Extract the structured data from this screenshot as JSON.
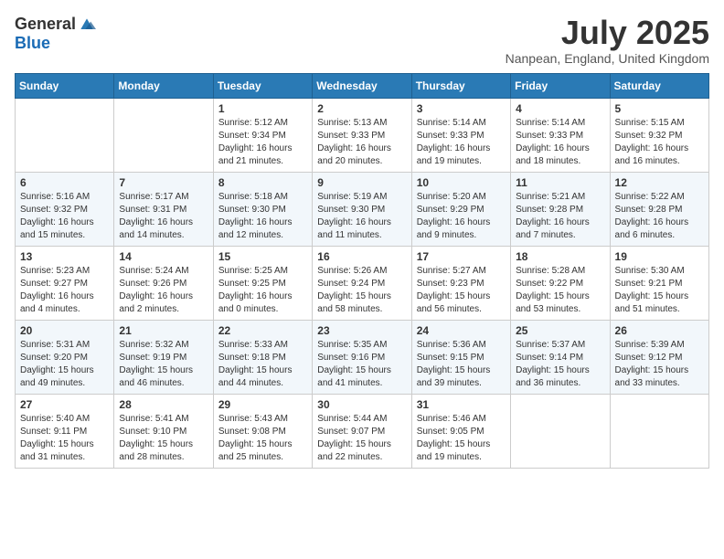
{
  "header": {
    "logo_general": "General",
    "logo_blue": "Blue",
    "month_title": "July 2025",
    "location": "Nanpean, England, United Kingdom"
  },
  "days_of_week": [
    "Sunday",
    "Monday",
    "Tuesday",
    "Wednesday",
    "Thursday",
    "Friday",
    "Saturday"
  ],
  "weeks": [
    [
      null,
      null,
      {
        "day": "1",
        "sunrise": "Sunrise: 5:12 AM",
        "sunset": "Sunset: 9:34 PM",
        "daylight": "Daylight: 16 hours and 21 minutes."
      },
      {
        "day": "2",
        "sunrise": "Sunrise: 5:13 AM",
        "sunset": "Sunset: 9:33 PM",
        "daylight": "Daylight: 16 hours and 20 minutes."
      },
      {
        "day": "3",
        "sunrise": "Sunrise: 5:14 AM",
        "sunset": "Sunset: 9:33 PM",
        "daylight": "Daylight: 16 hours and 19 minutes."
      },
      {
        "day": "4",
        "sunrise": "Sunrise: 5:14 AM",
        "sunset": "Sunset: 9:33 PM",
        "daylight": "Daylight: 16 hours and 18 minutes."
      },
      {
        "day": "5",
        "sunrise": "Sunrise: 5:15 AM",
        "sunset": "Sunset: 9:32 PM",
        "daylight": "Daylight: 16 hours and 16 minutes."
      }
    ],
    [
      {
        "day": "6",
        "sunrise": "Sunrise: 5:16 AM",
        "sunset": "Sunset: 9:32 PM",
        "daylight": "Daylight: 16 hours and 15 minutes."
      },
      {
        "day": "7",
        "sunrise": "Sunrise: 5:17 AM",
        "sunset": "Sunset: 9:31 PM",
        "daylight": "Daylight: 16 hours and 14 minutes."
      },
      {
        "day": "8",
        "sunrise": "Sunrise: 5:18 AM",
        "sunset": "Sunset: 9:30 PM",
        "daylight": "Daylight: 16 hours and 12 minutes."
      },
      {
        "day": "9",
        "sunrise": "Sunrise: 5:19 AM",
        "sunset": "Sunset: 9:30 PM",
        "daylight": "Daylight: 16 hours and 11 minutes."
      },
      {
        "day": "10",
        "sunrise": "Sunrise: 5:20 AM",
        "sunset": "Sunset: 9:29 PM",
        "daylight": "Daylight: 16 hours and 9 minutes."
      },
      {
        "day": "11",
        "sunrise": "Sunrise: 5:21 AM",
        "sunset": "Sunset: 9:28 PM",
        "daylight": "Daylight: 16 hours and 7 minutes."
      },
      {
        "day": "12",
        "sunrise": "Sunrise: 5:22 AM",
        "sunset": "Sunset: 9:28 PM",
        "daylight": "Daylight: 16 hours and 6 minutes."
      }
    ],
    [
      {
        "day": "13",
        "sunrise": "Sunrise: 5:23 AM",
        "sunset": "Sunset: 9:27 PM",
        "daylight": "Daylight: 16 hours and 4 minutes."
      },
      {
        "day": "14",
        "sunrise": "Sunrise: 5:24 AM",
        "sunset": "Sunset: 9:26 PM",
        "daylight": "Daylight: 16 hours and 2 minutes."
      },
      {
        "day": "15",
        "sunrise": "Sunrise: 5:25 AM",
        "sunset": "Sunset: 9:25 PM",
        "daylight": "Daylight: 16 hours and 0 minutes."
      },
      {
        "day": "16",
        "sunrise": "Sunrise: 5:26 AM",
        "sunset": "Sunset: 9:24 PM",
        "daylight": "Daylight: 15 hours and 58 minutes."
      },
      {
        "day": "17",
        "sunrise": "Sunrise: 5:27 AM",
        "sunset": "Sunset: 9:23 PM",
        "daylight": "Daylight: 15 hours and 56 minutes."
      },
      {
        "day": "18",
        "sunrise": "Sunrise: 5:28 AM",
        "sunset": "Sunset: 9:22 PM",
        "daylight": "Daylight: 15 hours and 53 minutes."
      },
      {
        "day": "19",
        "sunrise": "Sunrise: 5:30 AM",
        "sunset": "Sunset: 9:21 PM",
        "daylight": "Daylight: 15 hours and 51 minutes."
      }
    ],
    [
      {
        "day": "20",
        "sunrise": "Sunrise: 5:31 AM",
        "sunset": "Sunset: 9:20 PM",
        "daylight": "Daylight: 15 hours and 49 minutes."
      },
      {
        "day": "21",
        "sunrise": "Sunrise: 5:32 AM",
        "sunset": "Sunset: 9:19 PM",
        "daylight": "Daylight: 15 hours and 46 minutes."
      },
      {
        "day": "22",
        "sunrise": "Sunrise: 5:33 AM",
        "sunset": "Sunset: 9:18 PM",
        "daylight": "Daylight: 15 hours and 44 minutes."
      },
      {
        "day": "23",
        "sunrise": "Sunrise: 5:35 AM",
        "sunset": "Sunset: 9:16 PM",
        "daylight": "Daylight: 15 hours and 41 minutes."
      },
      {
        "day": "24",
        "sunrise": "Sunrise: 5:36 AM",
        "sunset": "Sunset: 9:15 PM",
        "daylight": "Daylight: 15 hours and 39 minutes."
      },
      {
        "day": "25",
        "sunrise": "Sunrise: 5:37 AM",
        "sunset": "Sunset: 9:14 PM",
        "daylight": "Daylight: 15 hours and 36 minutes."
      },
      {
        "day": "26",
        "sunrise": "Sunrise: 5:39 AM",
        "sunset": "Sunset: 9:12 PM",
        "daylight": "Daylight: 15 hours and 33 minutes."
      }
    ],
    [
      {
        "day": "27",
        "sunrise": "Sunrise: 5:40 AM",
        "sunset": "Sunset: 9:11 PM",
        "daylight": "Daylight: 15 hours and 31 minutes."
      },
      {
        "day": "28",
        "sunrise": "Sunrise: 5:41 AM",
        "sunset": "Sunset: 9:10 PM",
        "daylight": "Daylight: 15 hours and 28 minutes."
      },
      {
        "day": "29",
        "sunrise": "Sunrise: 5:43 AM",
        "sunset": "Sunset: 9:08 PM",
        "daylight": "Daylight: 15 hours and 25 minutes."
      },
      {
        "day": "30",
        "sunrise": "Sunrise: 5:44 AM",
        "sunset": "Sunset: 9:07 PM",
        "daylight": "Daylight: 15 hours and 22 minutes."
      },
      {
        "day": "31",
        "sunrise": "Sunrise: 5:46 AM",
        "sunset": "Sunset: 9:05 PM",
        "daylight": "Daylight: 15 hours and 19 minutes."
      },
      null,
      null
    ]
  ]
}
